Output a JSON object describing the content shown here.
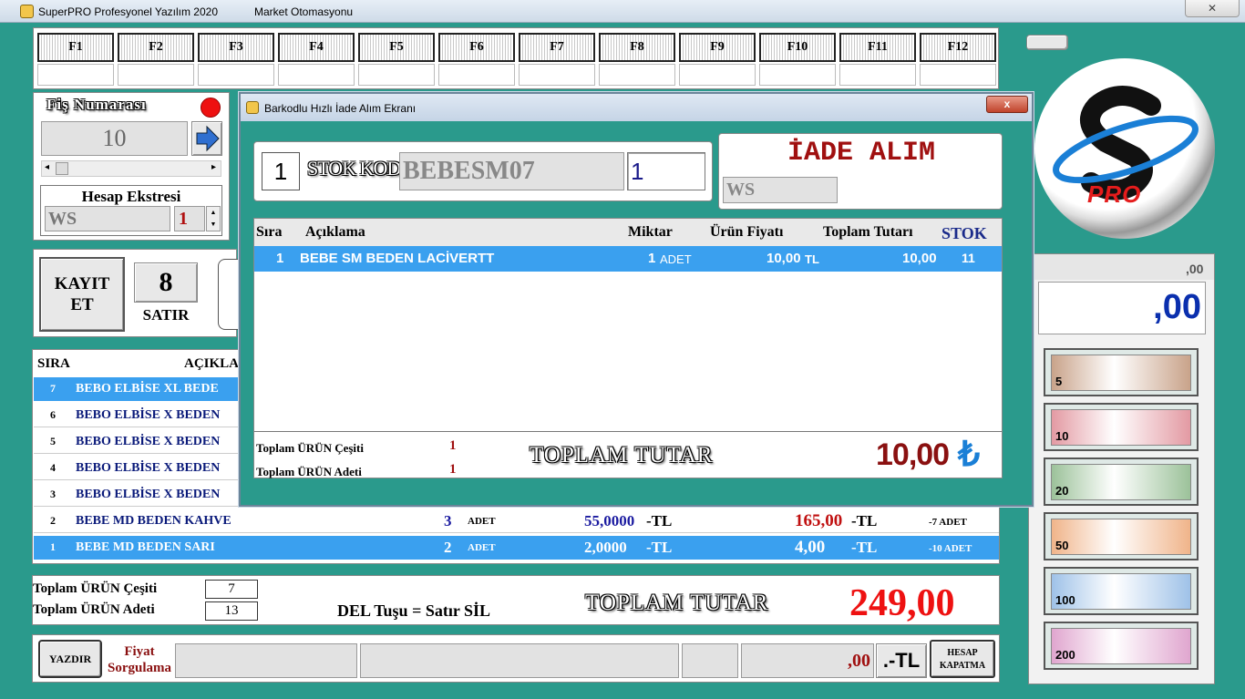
{
  "window": {
    "title": "SuperPRO Profesyonel Yazılım 2020",
    "subtitle": "Market Otomasyonu",
    "close_label": "✕"
  },
  "fkeys": [
    "F1",
    "F2",
    "F3",
    "F4",
    "F5",
    "F6",
    "F7",
    "F8",
    "F9",
    "F10",
    "F11",
    "F12"
  ],
  "receipt": {
    "label": "Fiş Numarası",
    "number": "10",
    "status_color": "#ee1111"
  },
  "account": {
    "label": "Hesap Ekstresi",
    "code": "WS",
    "qty": "1"
  },
  "save": {
    "label_line1": "KAYIT",
    "label_line2": "ET",
    "count": "8",
    "count_label": "SATIR"
  },
  "table": {
    "headers": {
      "sira": "SIRA",
      "aciklama": "AÇIKLA"
    },
    "rows": [
      {
        "sira": "7",
        "name": "BEBO ELBİSE XL BEDE",
        "qty": "",
        "unit": "",
        "price": "",
        "total": "",
        "stock": "",
        "selected": true
      },
      {
        "sira": "6",
        "name": "BEBO ELBİSE X BEDEN",
        "qty": "",
        "unit": "",
        "price": "",
        "total": "",
        "stock": "",
        "selected": false
      },
      {
        "sira": "5",
        "name": "BEBO ELBİSE X BEDEN",
        "qty": "",
        "unit": "",
        "price": "",
        "total": "",
        "stock": "",
        "selected": false
      },
      {
        "sira": "4",
        "name": "BEBO ELBİSE X BEDEN",
        "qty": "",
        "unit": "",
        "price": "",
        "total": "",
        "stock": "",
        "selected": false
      },
      {
        "sira": "3",
        "name": "BEBO ELBİSE X BEDEN",
        "qty": "",
        "unit": "",
        "price": "",
        "total": "",
        "stock": "",
        "selected": false
      },
      {
        "sira": "2",
        "name": "BEBE MD BEDEN KAHVE",
        "qty": "3",
        "unit": "ADET",
        "price": "55,0000",
        "total": "165,00",
        "stock": "-7 ADET",
        "selected": false
      },
      {
        "sira": "1",
        "name": "BEBE MD BEDEN SARI",
        "qty": "2",
        "unit": "ADET",
        "price": "2,0000",
        "total": "4,00",
        "stock": "-10 ADET",
        "selected": true
      }
    ],
    "currency_suffix": "-TL"
  },
  "totals": {
    "variety_label": "Toplam ÜRÜN Çeşiti",
    "variety": "7",
    "count_label": "Toplam ÜRÜN Adeti",
    "count": "13",
    "del_hint": "DEL Tuşu = Satır SİL",
    "total_label": "TOPLAM TUTAR",
    "total": "249,00"
  },
  "bottom": {
    "print": "YAZDIR",
    "price_check_1": "Fiyat",
    "price_check_2": "Sorgulama",
    "amount": ",00",
    "amount_suffix": ".-TL",
    "close_1": "HESAP",
    "close_2": "KAPATMA"
  },
  "right": {
    "small_amount": ",00",
    "big_amount": ",00",
    "logo_text": "PRO"
  },
  "money": [
    {
      "value": "5",
      "color": "#c9a38a"
    },
    {
      "value": "10",
      "color": "#e39aa3"
    },
    {
      "value": "20",
      "color": "#9cc29a"
    },
    {
      "value": "50",
      "color": "#f0b48a"
    },
    {
      "value": "100",
      "color": "#9fc2e8"
    },
    {
      "value": "200",
      "color": "#e0a6cf"
    }
  ],
  "dialog": {
    "title": "Barkodlu Hızlı İade Alım Ekranı",
    "close_label": "x",
    "qty": "1",
    "code_label": "STOK KODU",
    "code": "BEBESM07",
    "code_qty": "1",
    "mode": "İADE ALIM",
    "account": "WS",
    "headers": {
      "sira": "Sıra",
      "aciklama": "Açıklama",
      "miktar": "Miktar",
      "fiyat": "Ürün Fiyatı",
      "toplam": "Toplam Tutarı",
      "stok": "STOK"
    },
    "rows": [
      {
        "sira": "1",
        "name": "BEBE SM BEDEN LACİVERTT",
        "qty": "1",
        "unit": "ADET",
        "price": "10,00",
        "currency": "TL",
        "total": "10,00",
        "stock": "11"
      }
    ],
    "variety_label": "Toplam ÜRÜN Çeşiti",
    "variety": "1",
    "count_label": "Toplam ÜRÜN Adeti",
    "count": "1",
    "total_label": "TOPLAM TUTAR",
    "total": "10,00",
    "currency_symbol": "₺"
  }
}
